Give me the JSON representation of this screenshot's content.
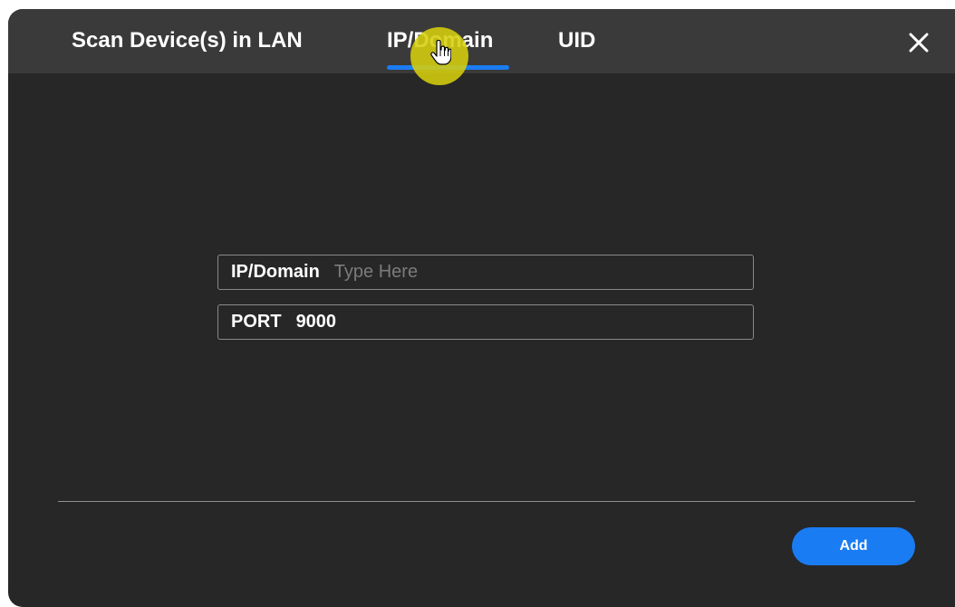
{
  "dialog": {
    "tabs": [
      {
        "label": "Scan Device(s) in LAN"
      },
      {
        "label": "IP/Domain"
      },
      {
        "label": "UID"
      }
    ],
    "active_tab": "IP/Domain",
    "close_icon": "close-icon"
  },
  "form": {
    "ip_domain": {
      "label": "IP/Domain",
      "placeholder": "Type Here",
      "value": ""
    },
    "port": {
      "label": "PORT",
      "value": "9000"
    }
  },
  "footer": {
    "add_label": "Add"
  },
  "colors": {
    "dialog_background": "#272727",
    "tab_bar_background": "#3a3a3a",
    "accent": "#1a7cf2",
    "cursor_highlight": "#d6ce0c"
  }
}
